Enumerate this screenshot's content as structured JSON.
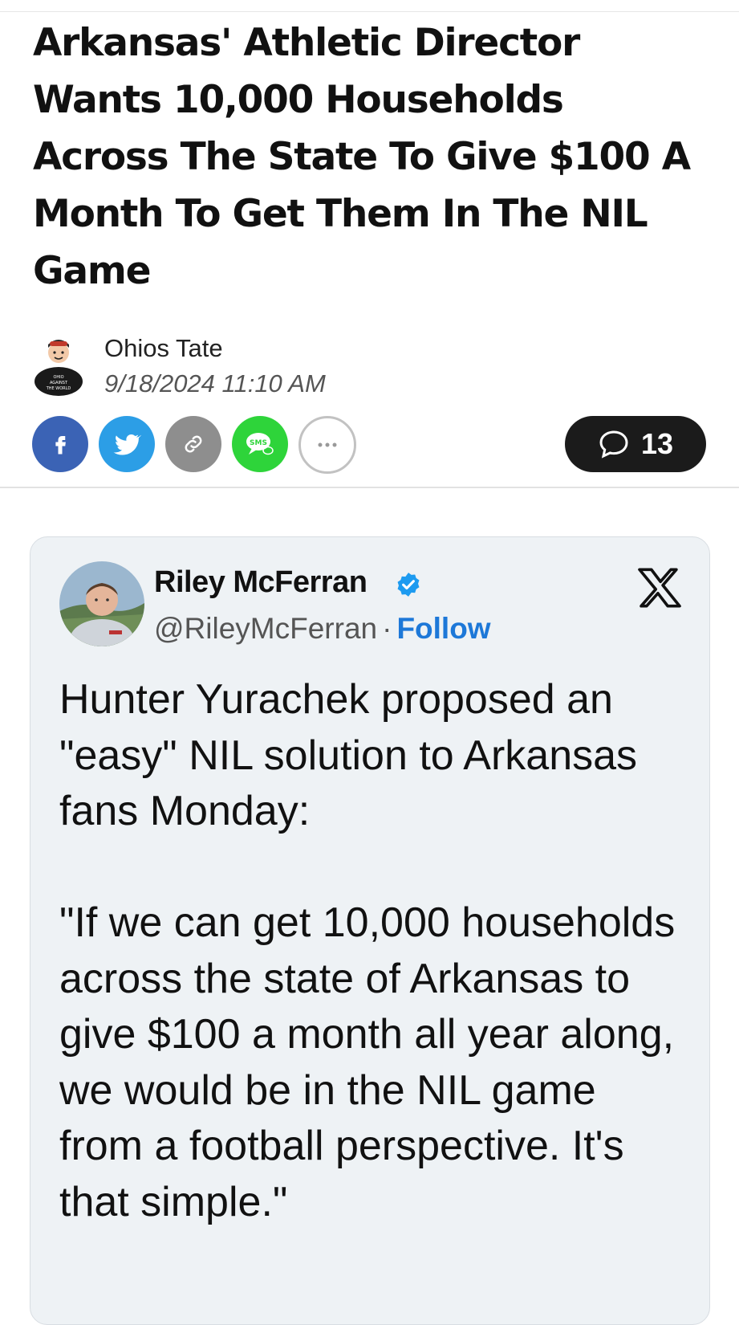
{
  "article": {
    "headline": "Arkansas' Athletic Director Wants 10,000 Households Across The State To Give $100 A Month To Get Them In The NIL Game",
    "author": "Ohios Tate",
    "date": "9/18/2024 11:10 AM"
  },
  "share": {
    "buttons": [
      {
        "name": "facebook",
        "icon": "facebook-icon",
        "color": "#3b63b5"
      },
      {
        "name": "twitter",
        "icon": "twitter-icon",
        "color": "#2c9ee6"
      },
      {
        "name": "copy-link",
        "icon": "link-icon",
        "color": "#8e8e8e"
      },
      {
        "name": "sms",
        "icon": "sms-icon",
        "label": "SMS",
        "color": "#2ed43a"
      },
      {
        "name": "more",
        "icon": "more-icon"
      }
    ],
    "comments_count": "13"
  },
  "tweet": {
    "display_name": "Riley McFerran",
    "handle": "@RileyMcFerran",
    "separator": "·",
    "follow_label": "Follow",
    "body": "Hunter Yurachek proposed an \"easy\" NIL solution to Arkansas fans Monday:\n\n\"If we can get 10,000 households across the state of Arkansas to give $100 a month all year along, we would be in the NIL game from a football perspective. It's that simple.\""
  },
  "colors": {
    "follow": "#1d78d8",
    "verified": "#1d9bf0",
    "card_bg": "#eef2f5"
  }
}
